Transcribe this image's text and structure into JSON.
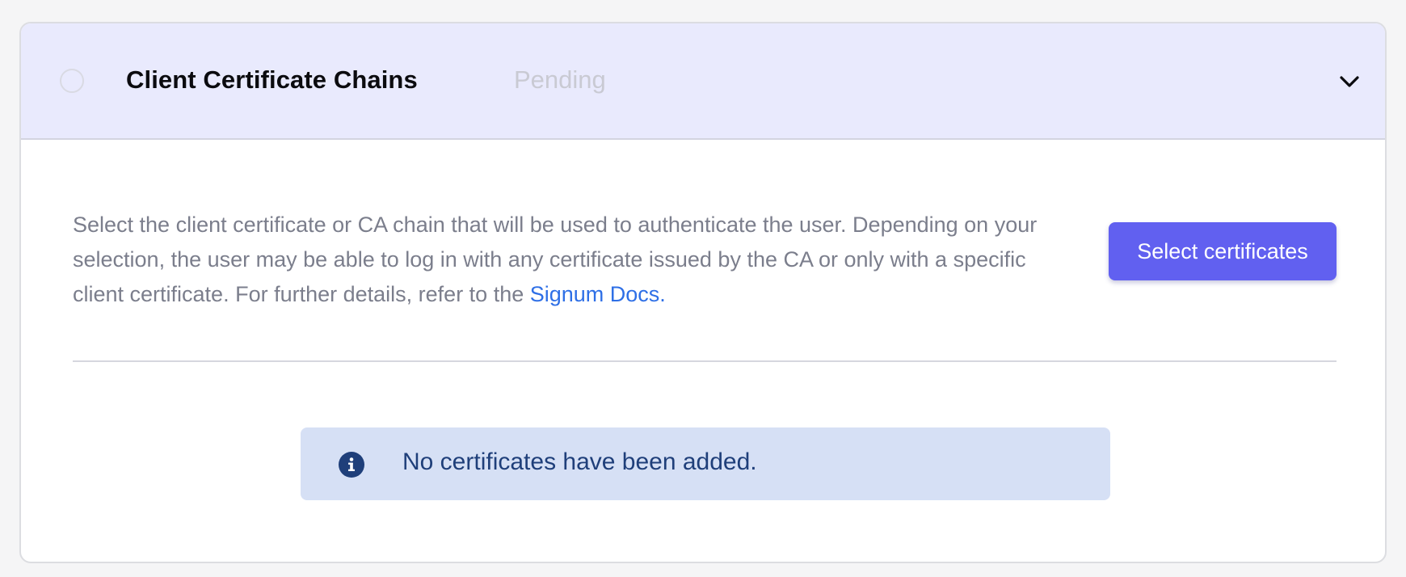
{
  "panel": {
    "title": "Client Certificate Chains",
    "status": "Pending",
    "expand_icon": "chevron-down-icon",
    "status_indicator": "empty-circle"
  },
  "content": {
    "description_text": "Select the client certificate or CA chain that will be used to authenticate the user. Depending on your selection, the user may be able to log in with any certificate issued by the CA or only with a specific client certificate. For further details, refer to the ",
    "docs_link_label": "Signum Docs.",
    "select_button_label": "Select certificates"
  },
  "empty_state": {
    "icon": "info-icon",
    "message": "No certificates have been added."
  },
  "colors": {
    "header_bg": "#e9eafd",
    "primary_button": "#6160f0",
    "link": "#2e6fe6",
    "info_banner_bg": "#d6e0f5",
    "info_text": "#1f3f7a",
    "info_icon": "#1f3f7a"
  }
}
